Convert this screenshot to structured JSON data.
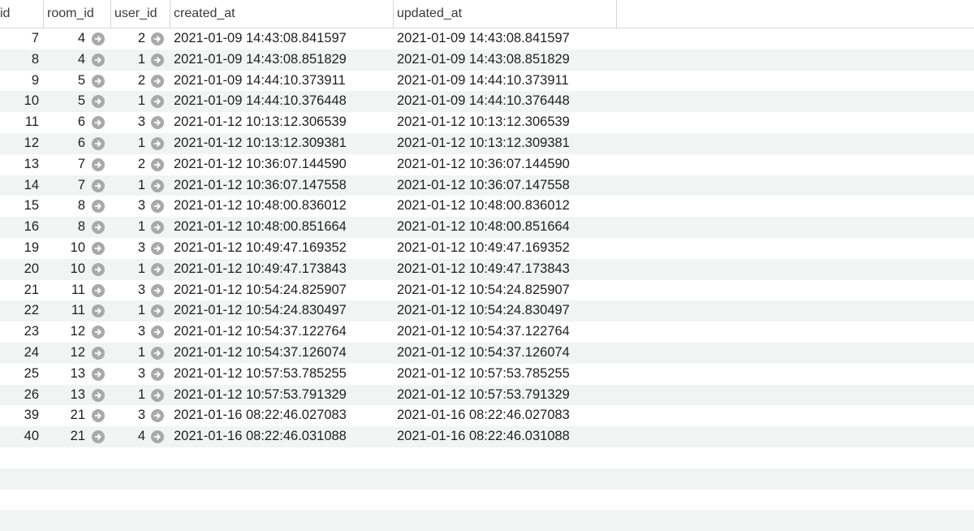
{
  "columns": {
    "id": "id",
    "room_id": "room_id",
    "user_id": "user_id",
    "created_at": "created_at",
    "updated_at": "updated_at"
  },
  "rows": [
    {
      "id": "7",
      "room_id": "4",
      "user_id": "2",
      "created_at": "2021-01-09 14:43:08.841597",
      "updated_at": "2021-01-09 14:43:08.841597"
    },
    {
      "id": "8",
      "room_id": "4",
      "user_id": "1",
      "created_at": "2021-01-09 14:43:08.851829",
      "updated_at": "2021-01-09 14:43:08.851829"
    },
    {
      "id": "9",
      "room_id": "5",
      "user_id": "2",
      "created_at": "2021-01-09 14:44:10.373911",
      "updated_at": "2021-01-09 14:44:10.373911"
    },
    {
      "id": "10",
      "room_id": "5",
      "user_id": "1",
      "created_at": "2021-01-09 14:44:10.376448",
      "updated_at": "2021-01-09 14:44:10.376448"
    },
    {
      "id": "11",
      "room_id": "6",
      "user_id": "3",
      "created_at": "2021-01-12 10:13:12.306539",
      "updated_at": "2021-01-12 10:13:12.306539"
    },
    {
      "id": "12",
      "room_id": "6",
      "user_id": "1",
      "created_at": "2021-01-12 10:13:12.309381",
      "updated_at": "2021-01-12 10:13:12.309381"
    },
    {
      "id": "13",
      "room_id": "7",
      "user_id": "2",
      "created_at": "2021-01-12 10:36:07.144590",
      "updated_at": "2021-01-12 10:36:07.144590"
    },
    {
      "id": "14",
      "room_id": "7",
      "user_id": "1",
      "created_at": "2021-01-12 10:36:07.147558",
      "updated_at": "2021-01-12 10:36:07.147558"
    },
    {
      "id": "15",
      "room_id": "8",
      "user_id": "3",
      "created_at": "2021-01-12 10:48:00.836012",
      "updated_at": "2021-01-12 10:48:00.836012"
    },
    {
      "id": "16",
      "room_id": "8",
      "user_id": "1",
      "created_at": "2021-01-12 10:48:00.851664",
      "updated_at": "2021-01-12 10:48:00.851664"
    },
    {
      "id": "19",
      "room_id": "10",
      "user_id": "3",
      "created_at": "2021-01-12 10:49:47.169352",
      "updated_at": "2021-01-12 10:49:47.169352"
    },
    {
      "id": "20",
      "room_id": "10",
      "user_id": "1",
      "created_at": "2021-01-12 10:49:47.173843",
      "updated_at": "2021-01-12 10:49:47.173843"
    },
    {
      "id": "21",
      "room_id": "11",
      "user_id": "3",
      "created_at": "2021-01-12 10:54:24.825907",
      "updated_at": "2021-01-12 10:54:24.825907"
    },
    {
      "id": "22",
      "room_id": "11",
      "user_id": "1",
      "created_at": "2021-01-12 10:54:24.830497",
      "updated_at": "2021-01-12 10:54:24.830497"
    },
    {
      "id": "23",
      "room_id": "12",
      "user_id": "3",
      "created_at": "2021-01-12 10:54:37.122764",
      "updated_at": "2021-01-12 10:54:37.122764"
    },
    {
      "id": "24",
      "room_id": "12",
      "user_id": "1",
      "created_at": "2021-01-12 10:54:37.126074",
      "updated_at": "2021-01-12 10:54:37.126074"
    },
    {
      "id": "25",
      "room_id": "13",
      "user_id": "3",
      "created_at": "2021-01-12 10:57:53.785255",
      "updated_at": "2021-01-12 10:57:53.785255"
    },
    {
      "id": "26",
      "room_id": "13",
      "user_id": "1",
      "created_at": "2021-01-12 10:57:53.791329",
      "updated_at": "2021-01-12 10:57:53.791329"
    },
    {
      "id": "39",
      "room_id": "21",
      "user_id": "3",
      "created_at": "2021-01-16 08:22:46.027083",
      "updated_at": "2021-01-16 08:22:46.027083"
    },
    {
      "id": "40",
      "room_id": "21",
      "user_id": "4",
      "created_at": "2021-01-16 08:22:46.031088",
      "updated_at": "2021-01-16 08:22:46.031088"
    }
  ],
  "fk_icon": "arrow-right-circle-icon",
  "colors": {
    "stripe": "#f2f4f4",
    "fk_icon": "#a9a9a9",
    "header_border": "#d8d8d8"
  }
}
